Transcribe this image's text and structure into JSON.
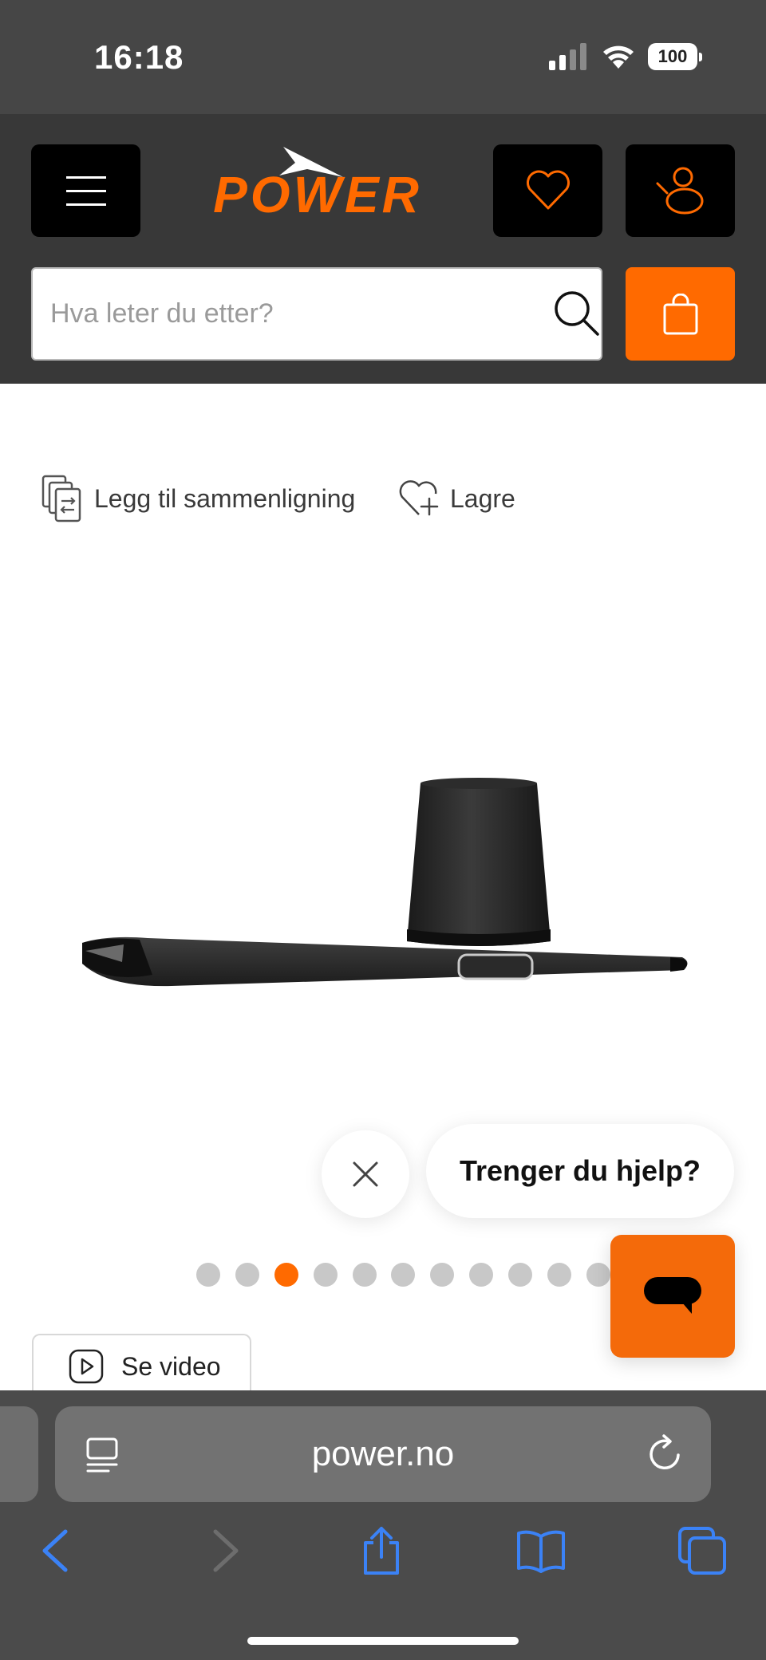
{
  "status_bar": {
    "time": "16:18",
    "battery": "100"
  },
  "header": {
    "logo_text": "POWER",
    "search_placeholder": "Hva leter du etter?"
  },
  "product": {
    "compare_label": "Legg til sammenligning",
    "save_label": "Lagre",
    "video_label": "Se video"
  },
  "carousel": {
    "total_visible_dots": 11,
    "active_index": 2
  },
  "chat": {
    "prompt": "Trenger du hjelp?"
  },
  "browser": {
    "url": "power.no"
  },
  "colors": {
    "brand": "#ff6a00",
    "header_bg": "#383838",
    "status_bg": "#464646",
    "browser_blue": "#3b82f6"
  }
}
